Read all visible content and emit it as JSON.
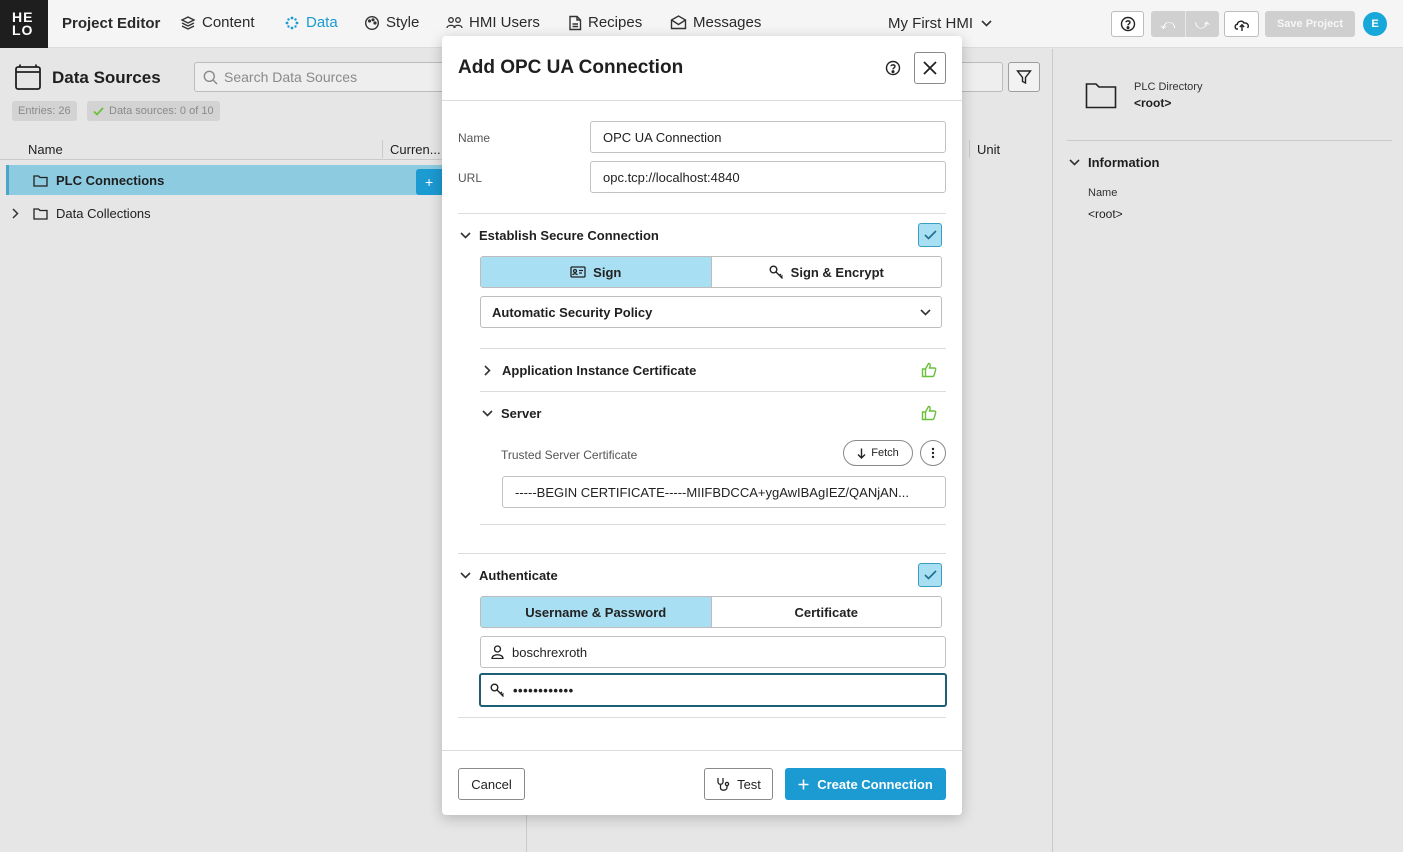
{
  "topbar": {
    "logo": [
      "HE",
      "LO"
    ],
    "app_title": "Project Editor",
    "nav": [
      {
        "label": "Content",
        "icon": "layers-icon"
      },
      {
        "label": "Data",
        "icon": "data-dots-icon",
        "active": true
      },
      {
        "label": "Style",
        "icon": "palette-icon"
      },
      {
        "label": "HMI Users",
        "icon": "users-icon"
      },
      {
        "label": "Recipes",
        "icon": "document-icon"
      },
      {
        "label": "Messages",
        "icon": "envelope-icon"
      }
    ],
    "project": "My First HMI",
    "save_label": "Save Project",
    "avatar_initial": "E"
  },
  "left_panel": {
    "title": "Data Sources",
    "search_placeholder": "Search Data Sources",
    "entries_label": "Entries: 26",
    "datasources_label": "Data sources: 0 of 10",
    "columns": {
      "name": "Name",
      "current": "Curren..."
    },
    "tree": [
      {
        "label": "PLC Connections",
        "selected": true
      },
      {
        "label": "Data Collections",
        "selected": false
      }
    ],
    "add_label": "+"
  },
  "middle": {
    "unit_header": "Unit"
  },
  "right_panel": {
    "item_type": "PLC Directory",
    "item_name": "<root>",
    "section_title": "Information",
    "name_label": "Name",
    "name_value": "<root>"
  },
  "modal": {
    "title": "Add OPC UA Connection",
    "name_label": "Name",
    "name_value": "OPC UA Connection",
    "url_label": "URL",
    "url_value": "opc.tcp://localhost:4840",
    "secure_section": "Establish Secure Connection",
    "secure_checked": true,
    "security_modes": [
      "Sign",
      "Sign & Encrypt"
    ],
    "security_policy": "Automatic Security Policy",
    "app_cert_section": "Application Instance Certificate",
    "server_section": "Server",
    "trusted_cert_label": "Trusted Server Certificate",
    "fetch_label": "Fetch",
    "cert_value": "-----BEGIN CERTIFICATE-----MIIFBDCCA+ygAwIBAgIEZ/QANjAN...",
    "auth_section": "Authenticate",
    "auth_checked": true,
    "auth_modes": [
      "Username & Password",
      "Certificate"
    ],
    "username": "boschrexroth",
    "password": "••••••••••••",
    "cancel_label": "Cancel",
    "test_label": "Test",
    "create_label": "Create Connection"
  },
  "colors": {
    "accent": "#1c9ad2",
    "selection": "#8ccbe0",
    "toggle_active": "#a9dff2",
    "ok_green": "#6cbf3a"
  }
}
